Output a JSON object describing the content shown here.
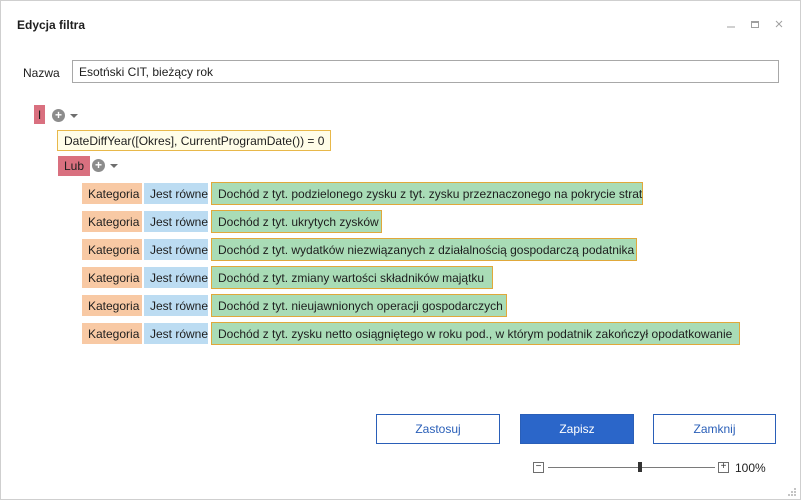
{
  "window": {
    "title": "Edycja filtra"
  },
  "name_field": {
    "label": "Nazwa",
    "value": "Esotński CIT, bieżący rok"
  },
  "tree": {
    "root_operator": "I",
    "expression": "DateDiffYear([Okres], CurrentProgramDate()) = 0",
    "group_operator": "Lub",
    "conditions": [
      {
        "field": "Kategoria",
        "operator": "Jest równe",
        "value": "Dochód z tyt. podzielonego zysku z tyt. zysku przeznaczonego na pokrycie strat"
      },
      {
        "field": "Kategoria",
        "operator": "Jest równe",
        "value": "Dochód z tyt. ukrytych zysków"
      },
      {
        "field": "Kategoria",
        "operator": "Jest równe",
        "value": "Dochód z tyt. wydatków niezwiązanych z działalnością gospodarczą podatnika"
      },
      {
        "field": "Kategoria",
        "operator": "Jest równe",
        "value": "Dochód z tyt. zmiany wartości składników majątku"
      },
      {
        "field": "Kategoria",
        "operator": "Jest równe",
        "value": "Dochód z tyt. nieujawnionych operacji gospodarczych"
      },
      {
        "field": "Kategoria",
        "operator": "Jest równe",
        "value": "Dochód z tyt. zysku netto osiągniętego w roku pod., w którym podatnik zakończył opodatkowanie"
      }
    ]
  },
  "buttons": {
    "apply": "Zastosuj",
    "save": "Zapisz",
    "close": "Zamknij"
  },
  "zoom": {
    "minus": "−",
    "plus": "+",
    "label": "100%",
    "level": 0.55
  },
  "colors": {
    "operator": "#d9707f",
    "field": "#f8c9a4",
    "op": "#bcdcf2",
    "value": "#a9dcb6",
    "accent": "#2b66c9"
  }
}
